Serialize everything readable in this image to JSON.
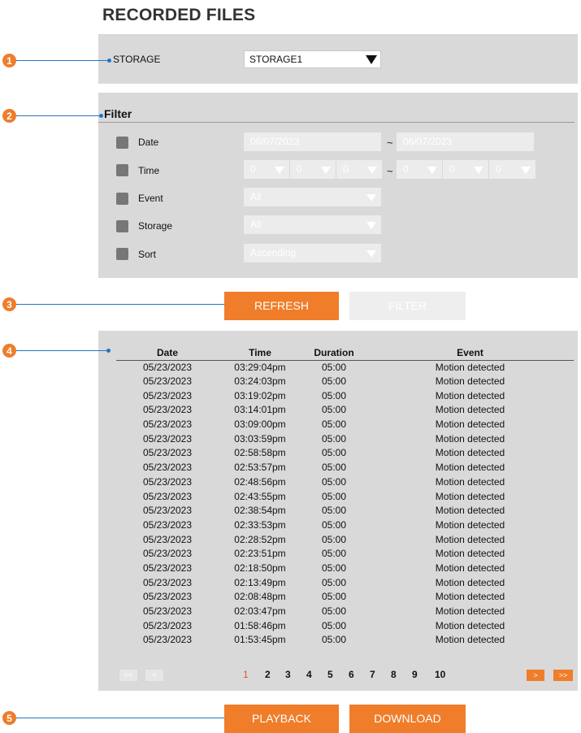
{
  "page_title": "RECORDED FILES",
  "callouts": [
    "1",
    "2",
    "3",
    "4",
    "5"
  ],
  "storage": {
    "label": "STORAGE",
    "value": "STORAGE1"
  },
  "filter": {
    "title": "Filter",
    "date": {
      "label": "Date",
      "from": "06/07/2023",
      "tilde": "~",
      "to": "06/07/2023"
    },
    "time": {
      "label": "Time",
      "values": [
        "0",
        "0",
        "0",
        "0",
        "0",
        "0"
      ],
      "tilde": "~"
    },
    "event": {
      "label": "Event",
      "value": "All"
    },
    "storage": {
      "label": "Storage",
      "value": "All"
    },
    "sort": {
      "label": "Sort",
      "value": "Ascending"
    }
  },
  "buttons": {
    "refresh": "REFRESH",
    "filter": "FILTER",
    "playback": "PLAYBACK",
    "download": "DOWNLOAD"
  },
  "table": {
    "headers": [
      "Date",
      "Time",
      "Duration",
      "Event"
    ],
    "rows": [
      [
        "05/23/2023",
        "03:29:04pm",
        "05:00",
        "Motion detected"
      ],
      [
        "05/23/2023",
        "03:24:03pm",
        "05:00",
        "Motion detected"
      ],
      [
        "05/23/2023",
        "03:19:02pm",
        "05:00",
        "Motion detected"
      ],
      [
        "05/23/2023",
        "03:14:01pm",
        "05:00",
        "Motion detected"
      ],
      [
        "05/23/2023",
        "03:09:00pm",
        "05:00",
        "Motion detected"
      ],
      [
        "05/23/2023",
        "03:03:59pm",
        "05:00",
        "Motion detected"
      ],
      [
        "05/23/2023",
        "02:58:58pm",
        "05:00",
        "Motion detected"
      ],
      [
        "05/23/2023",
        "02:53:57pm",
        "05:00",
        "Motion detected"
      ],
      [
        "05/23/2023",
        "02:48:56pm",
        "05:00",
        "Motion detected"
      ],
      [
        "05/23/2023",
        "02:43:55pm",
        "05:00",
        "Motion detected"
      ],
      [
        "05/23/2023",
        "02:38:54pm",
        "05:00",
        "Motion detected"
      ],
      [
        "05/23/2023",
        "02:33:53pm",
        "05:00",
        "Motion detected"
      ],
      [
        "05/23/2023",
        "02:28:52pm",
        "05:00",
        "Motion detected"
      ],
      [
        "05/23/2023",
        "02:23:51pm",
        "05:00",
        "Motion detected"
      ],
      [
        "05/23/2023",
        "02:18:50pm",
        "05:00",
        "Motion detected"
      ],
      [
        "05/23/2023",
        "02:13:49pm",
        "05:00",
        "Motion detected"
      ],
      [
        "05/23/2023",
        "02:08:48pm",
        "05:00",
        "Motion detected"
      ],
      [
        "05/23/2023",
        "02:03:47pm",
        "05:00",
        "Motion detected"
      ],
      [
        "05/23/2023",
        "01:58:46pm",
        "05:00",
        "Motion detected"
      ],
      [
        "05/23/2023",
        "01:53:45pm",
        "05:00",
        "Motion detected"
      ]
    ]
  },
  "pager": {
    "first": "<<",
    "prev": "<",
    "next": ">",
    "last": ">>",
    "pages": [
      "1",
      "2",
      "3",
      "4",
      "5",
      "6",
      "7",
      "8",
      "9",
      "10"
    ],
    "current": "1"
  },
  "colors": {
    "accent": "#ef7d2a",
    "callout_line": "#1f77c4",
    "panel": "#d9d9d9"
  }
}
